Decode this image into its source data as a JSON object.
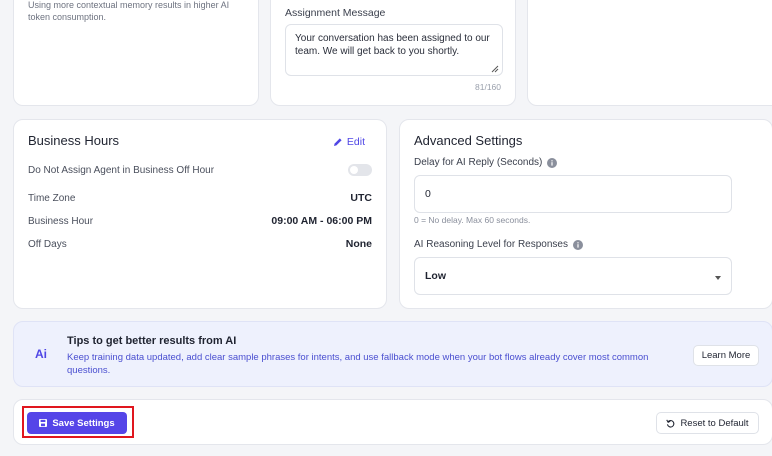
{
  "memory_card": {
    "note": "Using more contextual memory results in higher AI token consumption."
  },
  "assignment": {
    "label": "Assignment Message",
    "message": "Your conversation has been assigned to our team. We will get back to you shortly.",
    "char_count": "81/160"
  },
  "business_hours": {
    "title": "Business Hours",
    "edit_label": "Edit",
    "off_hour_label": "Do Not Assign Agent in Business Off Hour",
    "off_hour_enabled": false,
    "rows": [
      {
        "label": "Time Zone",
        "value": "UTC"
      },
      {
        "label": "Business Hour",
        "value": "09:00 AM - 06:00 PM"
      },
      {
        "label": "Off Days",
        "value": "None"
      }
    ]
  },
  "advanced": {
    "title": "Advanced Settings",
    "delay_label": "Delay for AI Reply (Seconds)",
    "delay_value": "0",
    "delay_help": "0 = No delay. Max 60 seconds.",
    "reasoning_label": "AI Reasoning Level for Responses",
    "reasoning_value": "Low"
  },
  "tips": {
    "badge": "Ai",
    "title": "Tips to get better results from AI",
    "body": "Keep training data updated, add clear sample phrases for intents, and use fallback mode when your bot flows already cover most common questions.",
    "learn_more": "Learn More"
  },
  "footer": {
    "save_label": "Save Settings",
    "reset_label": "Reset to Default"
  },
  "colors": {
    "accent": "#5545e8",
    "highlight": "#e0161e",
    "tips_bg": "#eef1fd"
  }
}
